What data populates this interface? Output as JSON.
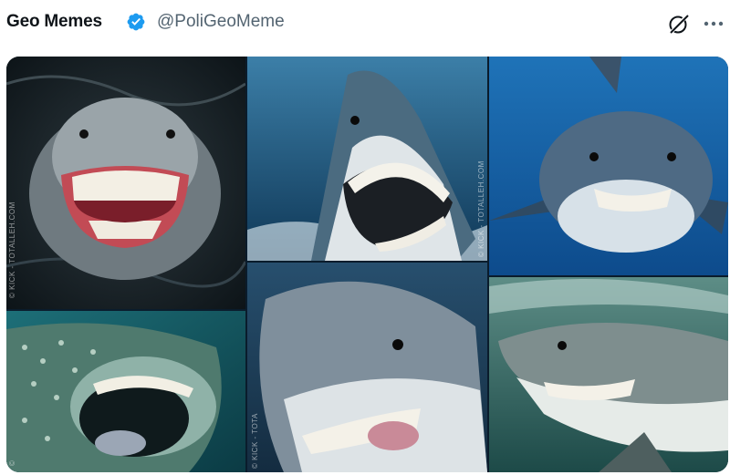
{
  "tweet": {
    "author_name": "Geo Memes",
    "author_handle": "@PoliGeoMeme",
    "icons": {
      "verified": "verified-badge-icon",
      "grok": "grok-icon",
      "more": "more-options-icon"
    }
  },
  "media": {
    "watermarks": {
      "t1": "© KICK - TOTALLEH.COM",
      "t2": "© KICK - TOTALLEH.COM",
      "t5": "© KICK - TOTA"
    }
  },
  "colors": {
    "text_primary": "#0f1419",
    "text_secondary": "#536471",
    "verified_blue": "#1d9bf0"
  }
}
